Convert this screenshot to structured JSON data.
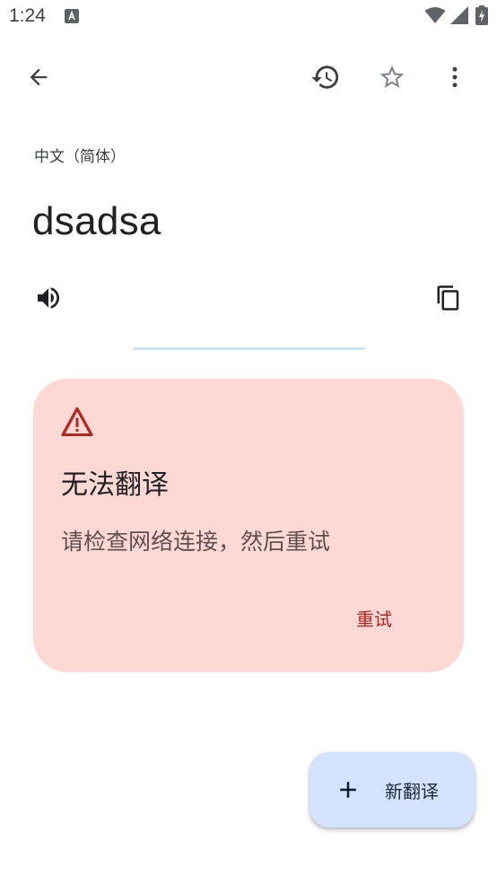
{
  "status_bar": {
    "time": "1:24"
  },
  "top_bar": {
    "back_icon": "arrow-left-icon",
    "history_icon": "history-icon",
    "star_icon": "star-outline-icon",
    "more_icon": "more-vert-icon"
  },
  "source": {
    "language": "中文（简体）",
    "text": "dsadsa",
    "speak_icon": "volume-icon",
    "copy_icon": "copy-icon"
  },
  "error": {
    "icon": "warning-icon",
    "title": "无法翻译",
    "message": "请检查网络连接，然后重试",
    "retry_label": "重试"
  },
  "fab": {
    "icon": "plus-icon",
    "label": "新翻译"
  },
  "colors": {
    "card_bg": "#fdd8d4",
    "error_red": "#b3261e",
    "fab_bg": "#d3e3fd",
    "divider": "#c9e6f5"
  }
}
